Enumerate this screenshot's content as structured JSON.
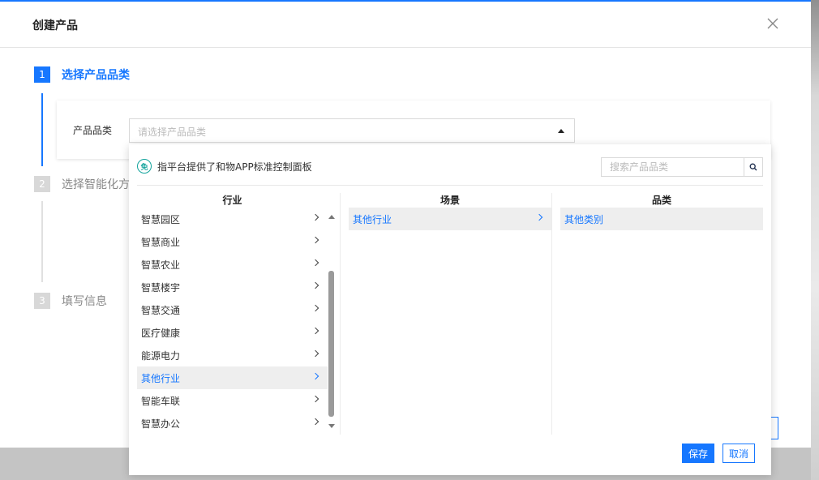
{
  "modal": {
    "title": "创建产品",
    "close_icon": "close-icon"
  },
  "steps": [
    {
      "num": "1",
      "label": "选择产品品类",
      "active": true
    },
    {
      "num": "2",
      "label": "选择智能化方案",
      "active": false
    },
    {
      "num": "3",
      "label": "填写信息",
      "active": false
    }
  ],
  "form": {
    "category_label": "产品品类",
    "category_placeholder": "请选择产品品类"
  },
  "dropdown": {
    "tip_icon_text": "免",
    "tip_text": "指平台提供了和物APP标准控制面板",
    "search_placeholder": "搜索产品品类",
    "columns": {
      "industry": {
        "header": "行业",
        "items": [
          "智慧园区",
          "智慧商业",
          "智慧农业",
          "智慧楼宇",
          "智慧交通",
          "医疗健康",
          "能源电力",
          "其他行业",
          "智能车联",
          "智慧办公"
        ],
        "selected_index": 7
      },
      "scene": {
        "header": "场景",
        "items": [
          "其他行业"
        ],
        "selected_index": 0
      },
      "category": {
        "header": "品类",
        "items": [
          "其他类别"
        ],
        "selected_index": 0
      }
    },
    "save_label": "保存",
    "cancel_label": "取消"
  },
  "colors": {
    "accent": "#1677ff",
    "tip_icon": "#12a39c"
  }
}
